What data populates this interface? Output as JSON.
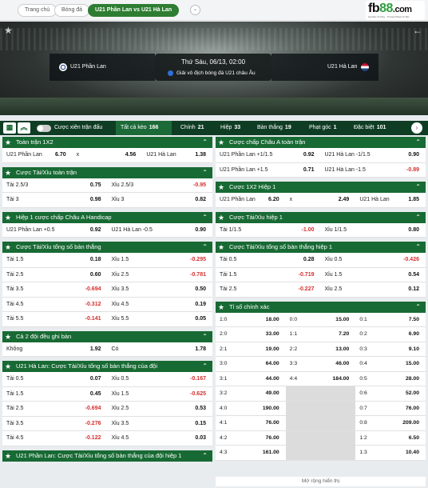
{
  "nav": {
    "home": "Trang chủ",
    "football": "Bóng đá",
    "match": "U21 Phần Lan vs U21 Hà Lan",
    "dropdown": "v"
  },
  "logo": {
    "brand": "fb",
    "num": "88",
    "suffix": ".com",
    "tagline": "Gamble To Play · Trusted Place To Bet"
  },
  "match": {
    "home": "U21 Phần Lan",
    "away": "U21 Hà Lan",
    "time": "Thứ Sáu, 06/13, 02:00",
    "league": "Giải vô địch bóng đá U21 châu Âu"
  },
  "tabs": {
    "toggle_label": "Cược xiên trận đấu",
    "items": [
      {
        "label": "Tất cả kèo",
        "count": "166"
      },
      {
        "label": "Chính",
        "count": "21"
      },
      {
        "label": "Hiệp",
        "count": "33"
      },
      {
        "label": "Bàn thắng",
        "count": "19"
      },
      {
        "label": "Phạt góc",
        "count": "1"
      },
      {
        "label": "Đặc biệt",
        "count": "101"
      }
    ]
  },
  "left": [
    {
      "title": "Toàn trận 1X2",
      "rows": [
        [
          [
            "U21 Phần Lan",
            "6.70"
          ],
          [
            "x",
            "4.56"
          ],
          [
            "U21 Hà Lan",
            "1.38"
          ]
        ]
      ]
    },
    {
      "title": "Cược Tài/Xỉu toàn trận",
      "rows": [
        [
          [
            "Tài 2.5/3",
            "0.75"
          ],
          [
            "Xỉu 2.5/3",
            "-0.95"
          ]
        ],
        [
          [
            "Tài 3",
            "0.98"
          ],
          [
            "Xỉu 3",
            "0.82"
          ]
        ]
      ]
    },
    {
      "title": "Hiệp 1 cược chấp Châu A Handicap",
      "rows": [
        [
          [
            "U21 Phần Lan +0.5",
            "0.92"
          ],
          [
            "U21 Hà Lan -0.5",
            "0.90"
          ]
        ]
      ]
    },
    {
      "title": "Cược Tài/Xỉu tổng số bàn thắng",
      "rows": [
        [
          [
            "Tài 1.5",
            "0.18"
          ],
          [
            "Xỉu 1.5",
            "-0.295"
          ]
        ],
        [
          [
            "Tài 2.5",
            "0.60"
          ],
          [
            "Xỉu 2.5",
            "-0.781"
          ]
        ],
        [
          [
            "Tài 3.5",
            "-0.694"
          ],
          [
            "Xỉu 3.5",
            "0.50"
          ]
        ],
        [
          [
            "Tài 4.5",
            "-0.312"
          ],
          [
            "Xỉu 4.5",
            "0.19"
          ]
        ],
        [
          [
            "Tài 5.5",
            "-0.141"
          ],
          [
            "Xỉu 5.5",
            "0.05"
          ]
        ]
      ]
    },
    {
      "title": "Cả 2 đội đều ghi bàn",
      "rows": [
        [
          [
            "Không",
            "1.92"
          ],
          [
            "Có",
            "1.78"
          ]
        ]
      ]
    },
    {
      "title": "U21 Hà Lan: Cược Tài/Xỉu tổng số bàn thắng của đội",
      "rows": [
        [
          [
            "Tài 0.5",
            "0.07"
          ],
          [
            "Xỉu 0.5",
            "-0.167"
          ]
        ],
        [
          [
            "Tài 1.5",
            "0.45"
          ],
          [
            "Xỉu 1.5",
            "-0.625"
          ]
        ],
        [
          [
            "Tài 2.5",
            "-0.694"
          ],
          [
            "Xỉu 2.5",
            "0.53"
          ]
        ],
        [
          [
            "Tài 3.5",
            "-0.276"
          ],
          [
            "Xỉu 3.5",
            "0.15"
          ]
        ],
        [
          [
            "Tài 4.5",
            "-0.122"
          ],
          [
            "Xỉu 4.5",
            "0.03"
          ]
        ]
      ]
    },
    {
      "title": "U21 Phần Lan: Cược Tài/Xỉu tổng số bàn thắng của đội hiệp 1",
      "rows": []
    }
  ],
  "right": [
    {
      "title": "Cược chấp Châu A toàn trận",
      "rows": [
        [
          [
            "U21 Phần Lan +1/1.5",
            "0.92"
          ],
          [
            "U21 Hà Lan -1/1.5",
            "0.90"
          ]
        ],
        [
          [
            "U21 Phần Lan +1.5",
            "0.71"
          ],
          [
            "U21 Hà Lan -1.5",
            "-0.89"
          ]
        ]
      ]
    },
    {
      "title": "Cược 1X2 Hiệp 1",
      "rows": [
        [
          [
            "U21 Phần Lan",
            "6.20"
          ],
          [
            "x",
            "2.49"
          ],
          [
            "U21 Hà Lan",
            "1.85"
          ]
        ]
      ]
    },
    {
      "title": "Cược Tài/Xỉu hiệp 1",
      "rows": [
        [
          [
            "Tài 1/1.5",
            "-1.00"
          ],
          [
            "Xỉu 1/1.5",
            "0.80"
          ]
        ]
      ]
    },
    {
      "title": "Cược Tài/Xỉu tổng số bàn thắng hiệp 1",
      "rows": [
        [
          [
            "Tài 0.5",
            "0.28"
          ],
          [
            "Xỉu 0.5",
            "-0.426"
          ]
        ],
        [
          [
            "Tài 1.5",
            "-0.719"
          ],
          [
            "Xỉu 1.5",
            "0.54"
          ]
        ],
        [
          [
            "Tài 2.5",
            "-0.227"
          ],
          [
            "Xỉu 2.5",
            "0.12"
          ]
        ]
      ]
    }
  ],
  "correct_score": {
    "title": "Tỉ số chính xác",
    "rows": [
      [
        [
          "1:0",
          "18.00"
        ],
        [
          "0:0",
          "15.00"
        ],
        [
          "0:1",
          "7.50"
        ]
      ],
      [
        [
          "2:0",
          "33.00"
        ],
        [
          "1:1",
          "7.20"
        ],
        [
          "0:2",
          "6.90"
        ]
      ],
      [
        [
          "2:1",
          "19.00"
        ],
        [
          "2:2",
          "13.00"
        ],
        [
          "0:3",
          "9.10"
        ]
      ],
      [
        [
          "3:0",
          "64.00"
        ],
        [
          "3:3",
          "46.00"
        ],
        [
          "0:4",
          "15.00"
        ]
      ],
      [
        [
          "3:1",
          "44.00"
        ],
        [
          "4:4",
          "184.00"
        ],
        [
          "0:5",
          "28.00"
        ]
      ],
      [
        [
          "3:2",
          "49.00"
        ],
        [
          "",
          ""
        ],
        [
          "0:6",
          "52.00"
        ]
      ],
      [
        [
          "4:0",
          "190.00"
        ],
        [
          "",
          ""
        ],
        [
          "0:7",
          "76.00"
        ]
      ],
      [
        [
          "4:1",
          "76.00"
        ],
        [
          "",
          ""
        ],
        [
          "0:8",
          "209.00"
        ]
      ],
      [
        [
          "4:2",
          "76.00"
        ],
        [
          "",
          ""
        ],
        [
          "1:2",
          "6.50"
        ]
      ],
      [
        [
          "4:3",
          "161.00"
        ],
        [
          "",
          ""
        ],
        [
          "1:3",
          "10.40"
        ]
      ]
    ],
    "more": "Mở rộng hiển thị"
  }
}
